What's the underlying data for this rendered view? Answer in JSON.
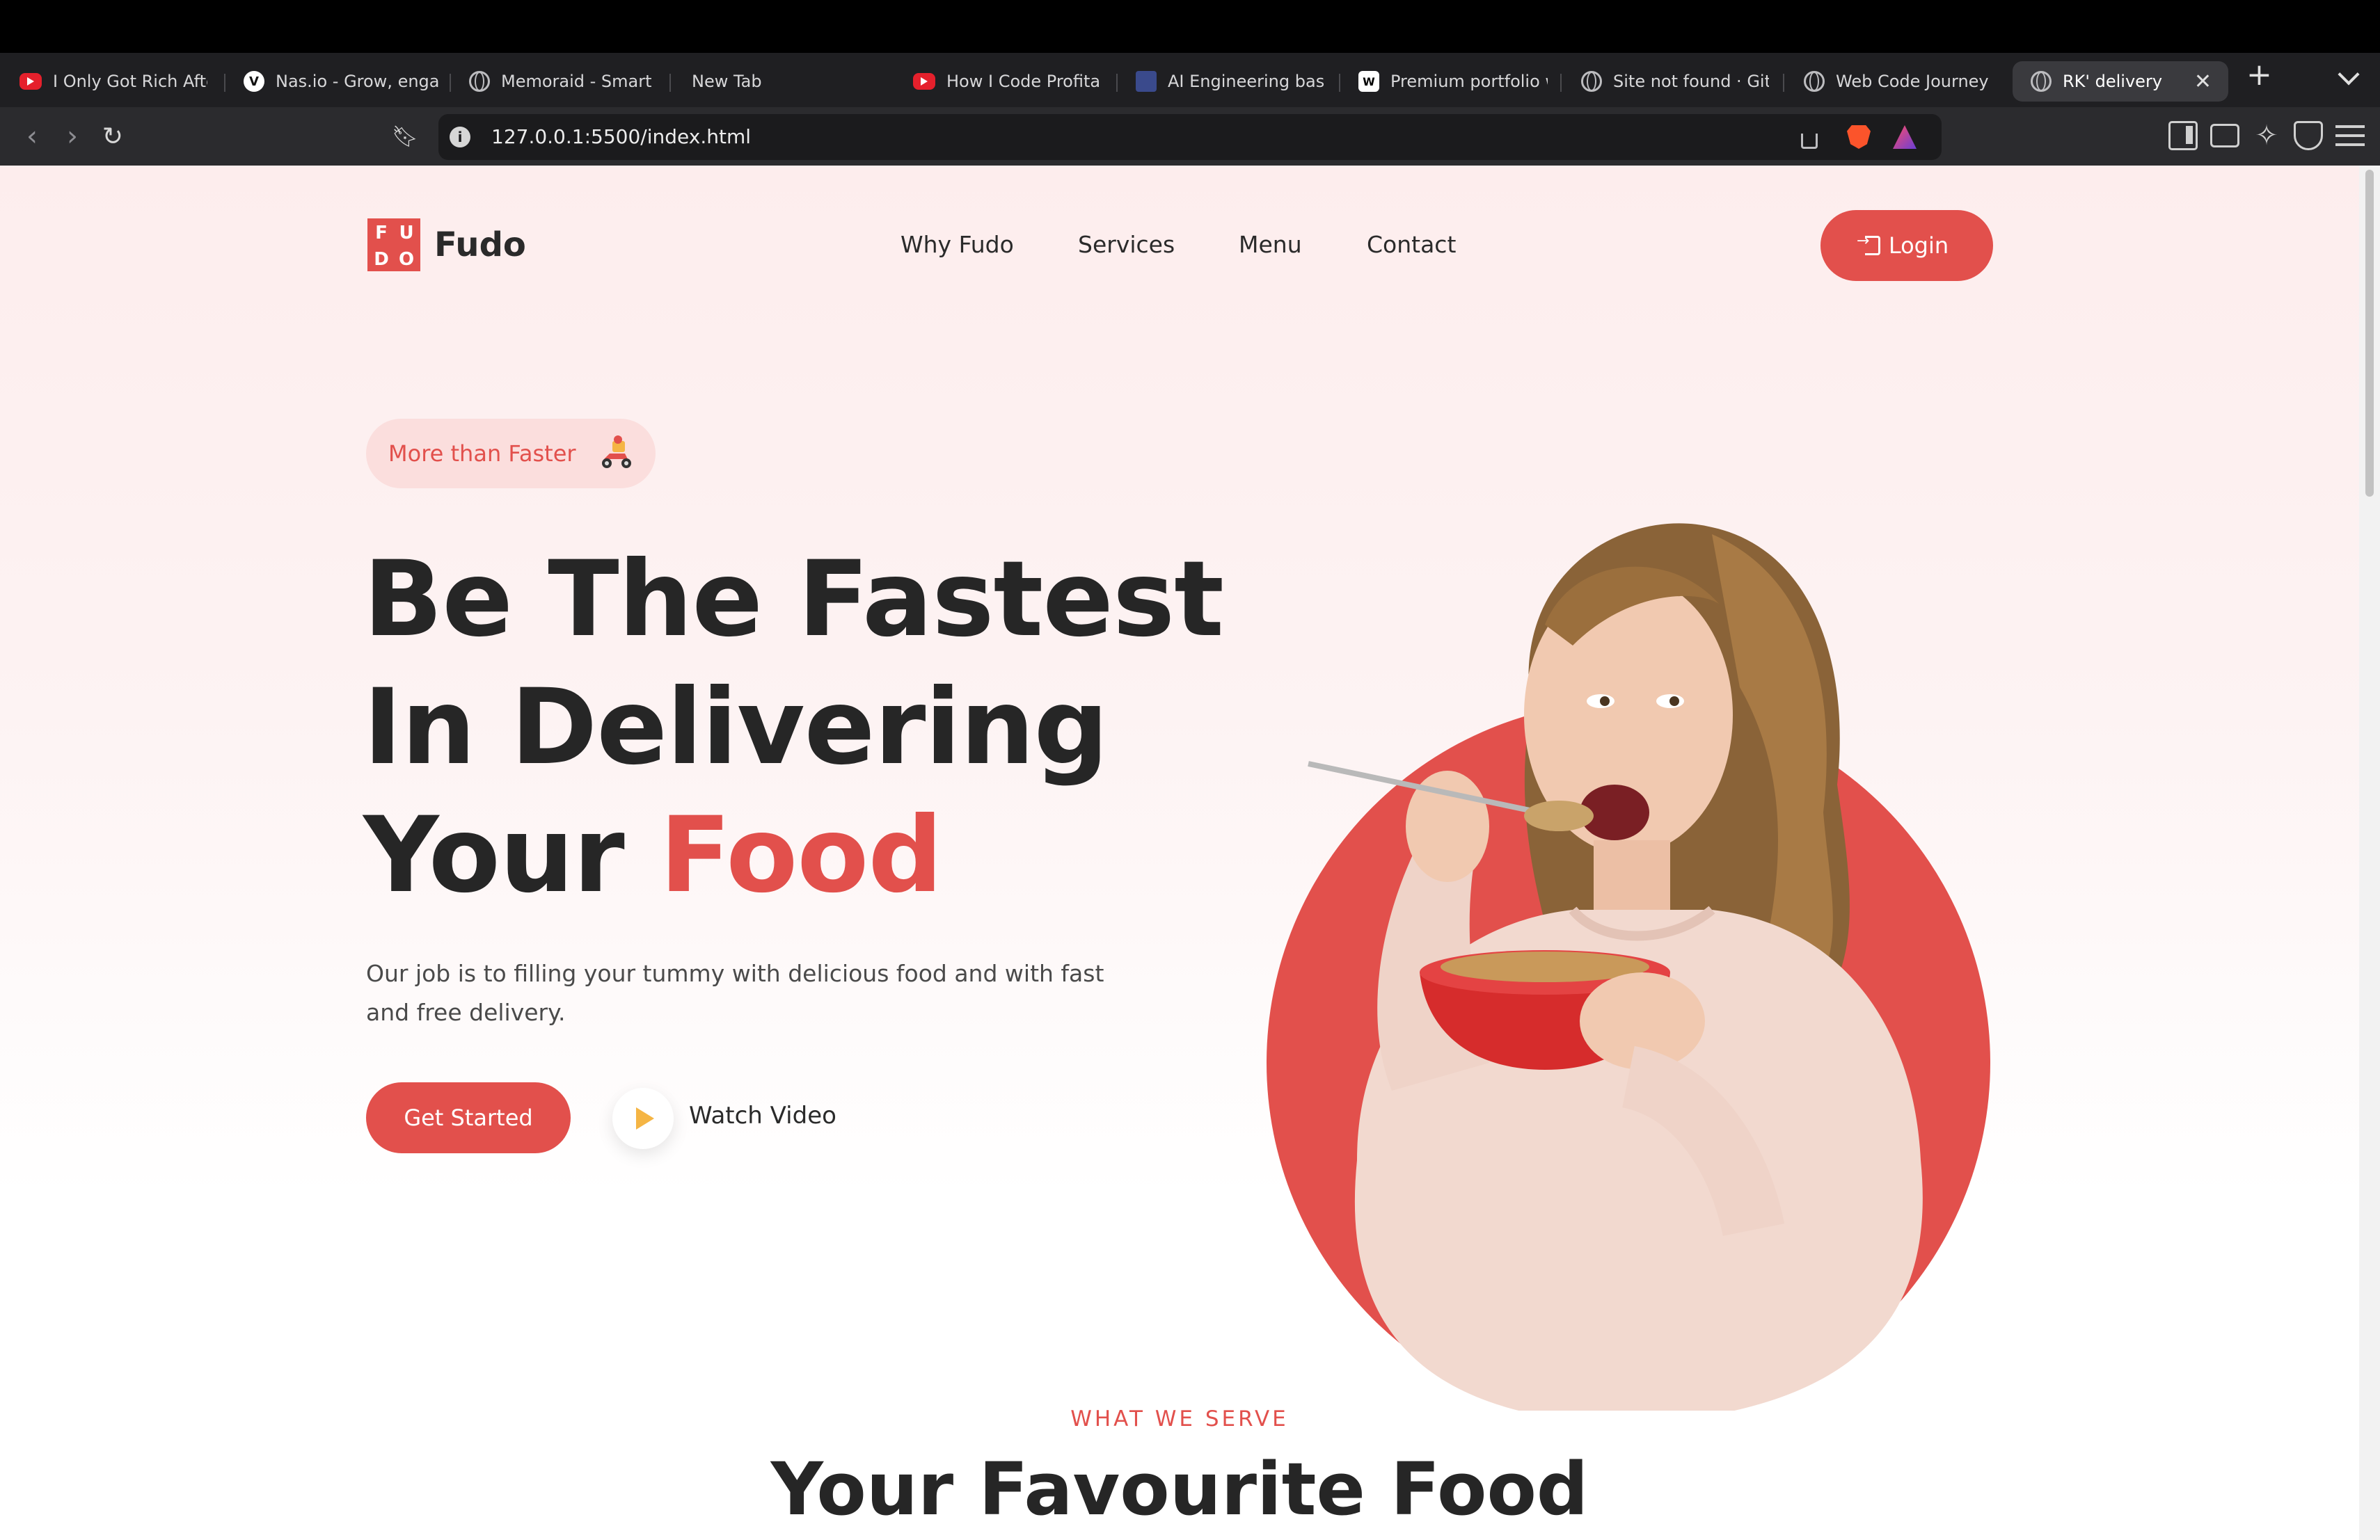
{
  "browser": {
    "tabs": [
      {
        "title": "I Only Got Rich Afte",
        "icon": "youtube-icon"
      },
      {
        "title": "Nas.io - Grow, enga",
        "icon": "nasio-icon"
      },
      {
        "title": "Memoraid - Smart F",
        "icon": "globe-icon"
      },
      {
        "title": "New Tab",
        "icon": ""
      },
      {
        "title": "How I Code Profital",
        "icon": "youtube-icon"
      },
      {
        "title": "AI Engineering basi",
        "icon": "ai-icon"
      },
      {
        "title": "Premium portfolio w",
        "icon": "premium-icon"
      },
      {
        "title": "Site not found · Gith",
        "icon": "globe-icon"
      },
      {
        "title": "Web Code Journey",
        "icon": "globe-icon"
      },
      {
        "title": "RK' delivery",
        "icon": "globe-icon",
        "active": true
      }
    ],
    "new_tab": "+",
    "close_tab": "✕",
    "url": "127.0.0.1:5500/index.html",
    "info_glyph": "i"
  },
  "site": {
    "logo_letters": [
      "F",
      "U",
      "D",
      "O"
    ],
    "logo_text": "Fudo",
    "nav": [
      "Why Fudo",
      "Services",
      "Menu",
      "Contact"
    ],
    "login": "Login",
    "badge": "More than Faster",
    "hero": {
      "line1": "Be The Fastest",
      "line2": "In Delivering",
      "line3a": "Your ",
      "line3b": "Food",
      "desc": "Our job is to filling your tummy with delicious food and with fast and free delivery.",
      "cta": "Get Started",
      "watch": "Watch Video"
    },
    "section": {
      "kicker": "WHAT WE SERVE",
      "title": "Your Favourite Food"
    },
    "colors": {
      "accent": "#e2504c",
      "text": "#262626",
      "badge_bg": "#fbdedd",
      "play": "#f5b544"
    }
  }
}
